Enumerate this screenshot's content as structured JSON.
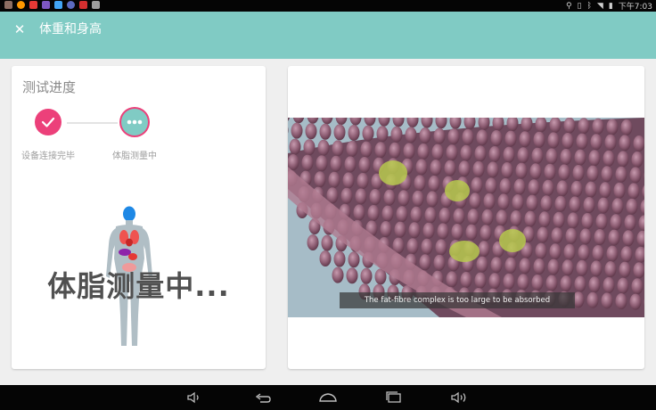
{
  "status_bar": {
    "time": "下午7:03",
    "left_icons": [
      "notification-icon-1",
      "notification-icon-2",
      "notification-icon-3",
      "notification-icon-4",
      "notification-icon-5",
      "notification-icon-6",
      "notification-icon-7",
      "notification-icon-8"
    ],
    "right_icons": [
      "location-icon",
      "bluetooth-icon",
      "vibrate-icon",
      "wifi-icon",
      "battery-icon"
    ]
  },
  "app_bar": {
    "title": "体重和身高",
    "close_icon": "close-icon",
    "color": "#80cbc4"
  },
  "progress_card": {
    "title": "测试进度",
    "steps": [
      {
        "label": "设备连接完毕",
        "state": "done",
        "icon": "check-icon",
        "color": "#ec407a"
      },
      {
        "label": "体脂测量中",
        "state": "active",
        "icon": "more-dots-icon",
        "color": "#80cbc4"
      }
    ],
    "overlay_text": "体脂测量中...",
    "figure": "human-body-anatomy-image"
  },
  "video_card": {
    "image": "intestinal-villi-video-frame",
    "subtitle": "The fat-fibre complex is too large to be absorbed"
  },
  "nav_bar": {
    "buttons": [
      "volume-down-icon",
      "back-icon",
      "home-icon",
      "recents-icon",
      "volume-up-icon"
    ]
  }
}
